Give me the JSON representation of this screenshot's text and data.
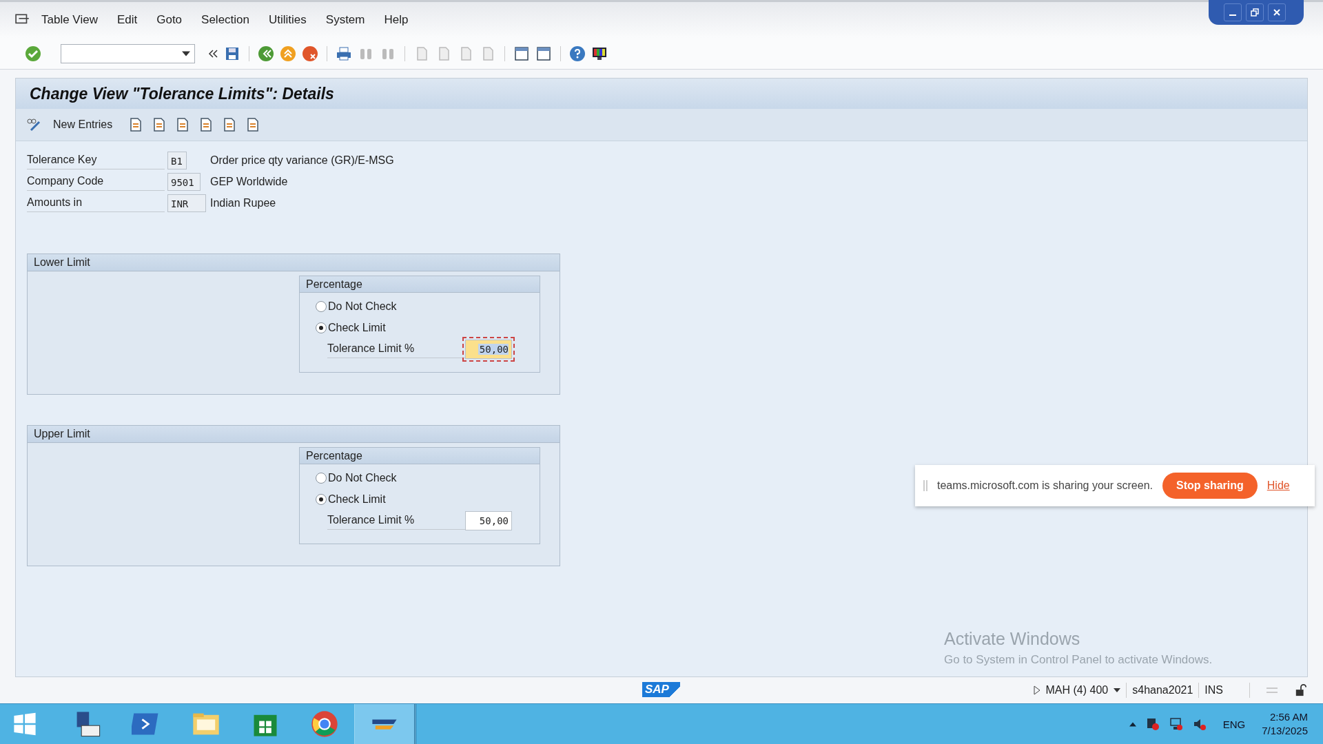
{
  "menu_bar": {
    "items": [
      "Table View",
      "Edit",
      "Goto",
      "Selection",
      "Utilities",
      "System",
      "Help"
    ]
  },
  "title": "Change View \"Tolerance Limits\": Details",
  "app_toolbar": {
    "new_entries": "New Entries"
  },
  "header_fields": [
    {
      "label": "Tolerance Key",
      "value": "B1",
      "description": "Order price qty variance (GR)/E-MSG"
    },
    {
      "label": "Company Code",
      "value": "9501",
      "description": "GEP Worldwide"
    },
    {
      "label": "Amounts in",
      "value": "INR",
      "description": "Indian Rupee"
    }
  ],
  "limit_groups": [
    {
      "title": "Lower Limit",
      "subgroup_title": "Percentage",
      "options": [
        {
          "label": "Do Not Check",
          "selected": false
        },
        {
          "label": "Check Limit",
          "selected": true
        }
      ],
      "field_label": "Tolerance Limit %",
      "field_value": "50,00",
      "focused": true
    },
    {
      "title": "Upper Limit",
      "subgroup_title": "Percentage",
      "options": [
        {
          "label": "Do Not Check",
          "selected": false
        },
        {
          "label": "Check Limit",
          "selected": true
        }
      ],
      "field_label": "Tolerance Limit %",
      "field_value": "50,00",
      "focused": false
    }
  ],
  "sharing_bar": {
    "message": "teams.microsoft.com is sharing your screen.",
    "stop_button": "Stop sharing",
    "hide_link": "Hide"
  },
  "activation_notice": {
    "title": "Activate Windows",
    "message": "Go to System in Control Panel to activate Windows."
  },
  "status_bar": {
    "logo": "SAP",
    "session": "MAH (4) 400",
    "server": "s4hana2021",
    "mode": "INS"
  },
  "taskbar": {
    "language": "ENG",
    "time": "2:56 AM",
    "date": "7/13/2025"
  }
}
